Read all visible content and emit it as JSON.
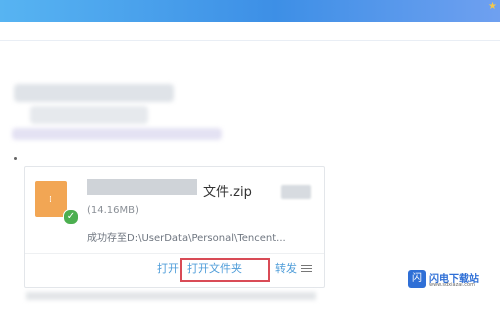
{
  "window": {
    "colors": {
      "title_bar": "#3d8fe6",
      "accent": "#4f9dd9",
      "highlight": "#d94b56",
      "file_icon": "#f2a654"
    }
  },
  "file_card": {
    "file_name": "文件.zip",
    "file_size": "(14.16MB)",
    "saved_path": "成功存至D:\\UserData\\Personal\\Tencent...",
    "actions": {
      "open": "打开",
      "open_folder": "打开文件夹",
      "forward": "转发"
    },
    "icons": {
      "file": "zip-file-icon",
      "status": "checkmark-icon",
      "menu": "menu-icon"
    }
  },
  "watermark": {
    "icon_char": "闪",
    "name": "闪电下载站",
    "url": "www.sdxiazai.com"
  }
}
